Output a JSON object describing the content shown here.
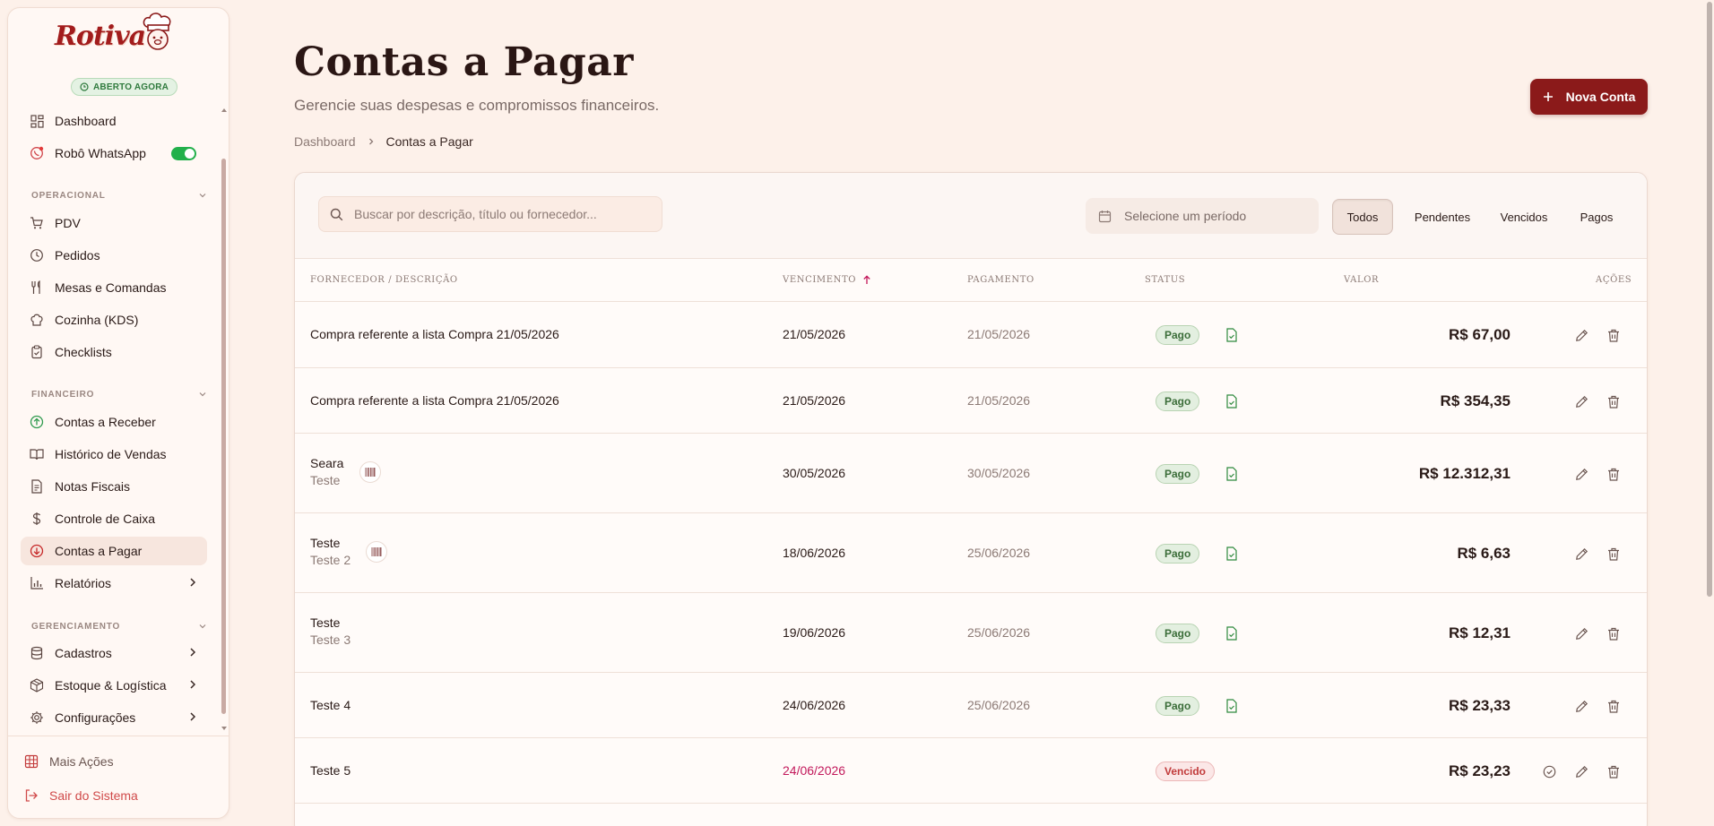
{
  "sidebar": {
    "brand": "Rotiva",
    "open_badge": "ABERTO AGORA",
    "top_items": [
      {
        "label": "Dashboard"
      },
      {
        "label": "Robô WhatsApp"
      }
    ],
    "sections": [
      {
        "title": "OPERACIONAL"
      },
      {
        "title": "FINANCEIRO"
      },
      {
        "title": "GERENCIAMENTO"
      }
    ],
    "operacional": [
      {
        "label": "PDV"
      },
      {
        "label": "Pedidos"
      },
      {
        "label": "Mesas e Comandas"
      },
      {
        "label": "Cozinha (KDS)"
      },
      {
        "label": "Checklists"
      }
    ],
    "financeiro": [
      {
        "label": "Contas a Receber"
      },
      {
        "label": "Histórico de Vendas"
      },
      {
        "label": "Notas Fiscais"
      },
      {
        "label": "Controle de Caixa"
      },
      {
        "label": "Contas a Pagar"
      },
      {
        "label": "Relatórios"
      }
    ],
    "gerenciamento": [
      {
        "label": "Cadastros"
      },
      {
        "label": "Estoque & Logística"
      },
      {
        "label": "Configurações"
      }
    ],
    "footer": {
      "more_actions": "Mais Ações",
      "logout": "Sair do Sistema"
    }
  },
  "header": {
    "title": "Contas a Pagar",
    "subtitle": "Gerencie suas despesas e compromissos financeiros.",
    "breadcrumb": [
      "Dashboard",
      "Contas a Pagar"
    ],
    "new_button": "Nova Conta"
  },
  "toolbar": {
    "search_placeholder": "Buscar por descrição, título ou fornecedor...",
    "period_placeholder": "Selecione um período",
    "filters": [
      "Todos",
      "Pendentes",
      "Vencidos",
      "Pagos"
    ],
    "active_filter": "Todos"
  },
  "table": {
    "columns": {
      "supplier": "FORNECEDOR / DESCRIÇÃO",
      "due": "VENCIMENTO",
      "payment": "PAGAMENTO",
      "status": "STATUS",
      "value": "VALOR",
      "actions": "AÇÕES"
    },
    "rows": [
      {
        "title": "Compra referente a lista Compra 21/05/2026",
        "sub": "",
        "due": "21/05/2026",
        "paid": "21/05/2026",
        "status": "Pago",
        "value": "R$ 67,00"
      },
      {
        "title": "Compra referente a lista Compra 21/05/2026",
        "sub": "",
        "due": "21/05/2026",
        "paid": "21/05/2026",
        "status": "Pago",
        "value": "R$ 354,35"
      },
      {
        "title": "Seara",
        "sub": "Teste",
        "due": "30/05/2026",
        "paid": "30/05/2026",
        "status": "Pago",
        "value": "R$ 12.312,31"
      },
      {
        "title": "Teste",
        "sub": "Teste 2",
        "due": "18/06/2026",
        "paid": "25/06/2026",
        "status": "Pago",
        "value": "R$ 6,63"
      },
      {
        "title": "Teste",
        "sub": "Teste 3",
        "due": "19/06/2026",
        "paid": "25/06/2026",
        "status": "Pago",
        "value": "R$ 12,31"
      },
      {
        "title": "Teste 4",
        "sub": "",
        "due": "24/06/2026",
        "paid": "25/06/2026",
        "status": "Pago",
        "value": "R$ 23,33"
      },
      {
        "title": "Teste 5",
        "sub": "",
        "due": "24/06/2026",
        "paid": "",
        "status": "Vencido",
        "value": "R$ 23,23"
      }
    ]
  },
  "colors": {
    "brand": "#a21c1c",
    "primary_button": "#8b1a1a",
    "background": "#fdf1ea",
    "paid_badge": "#3c6e3a",
    "overdue_badge": "#c23b3b",
    "overdue_date": "#c2185b",
    "toggle_on": "#22b04b"
  }
}
